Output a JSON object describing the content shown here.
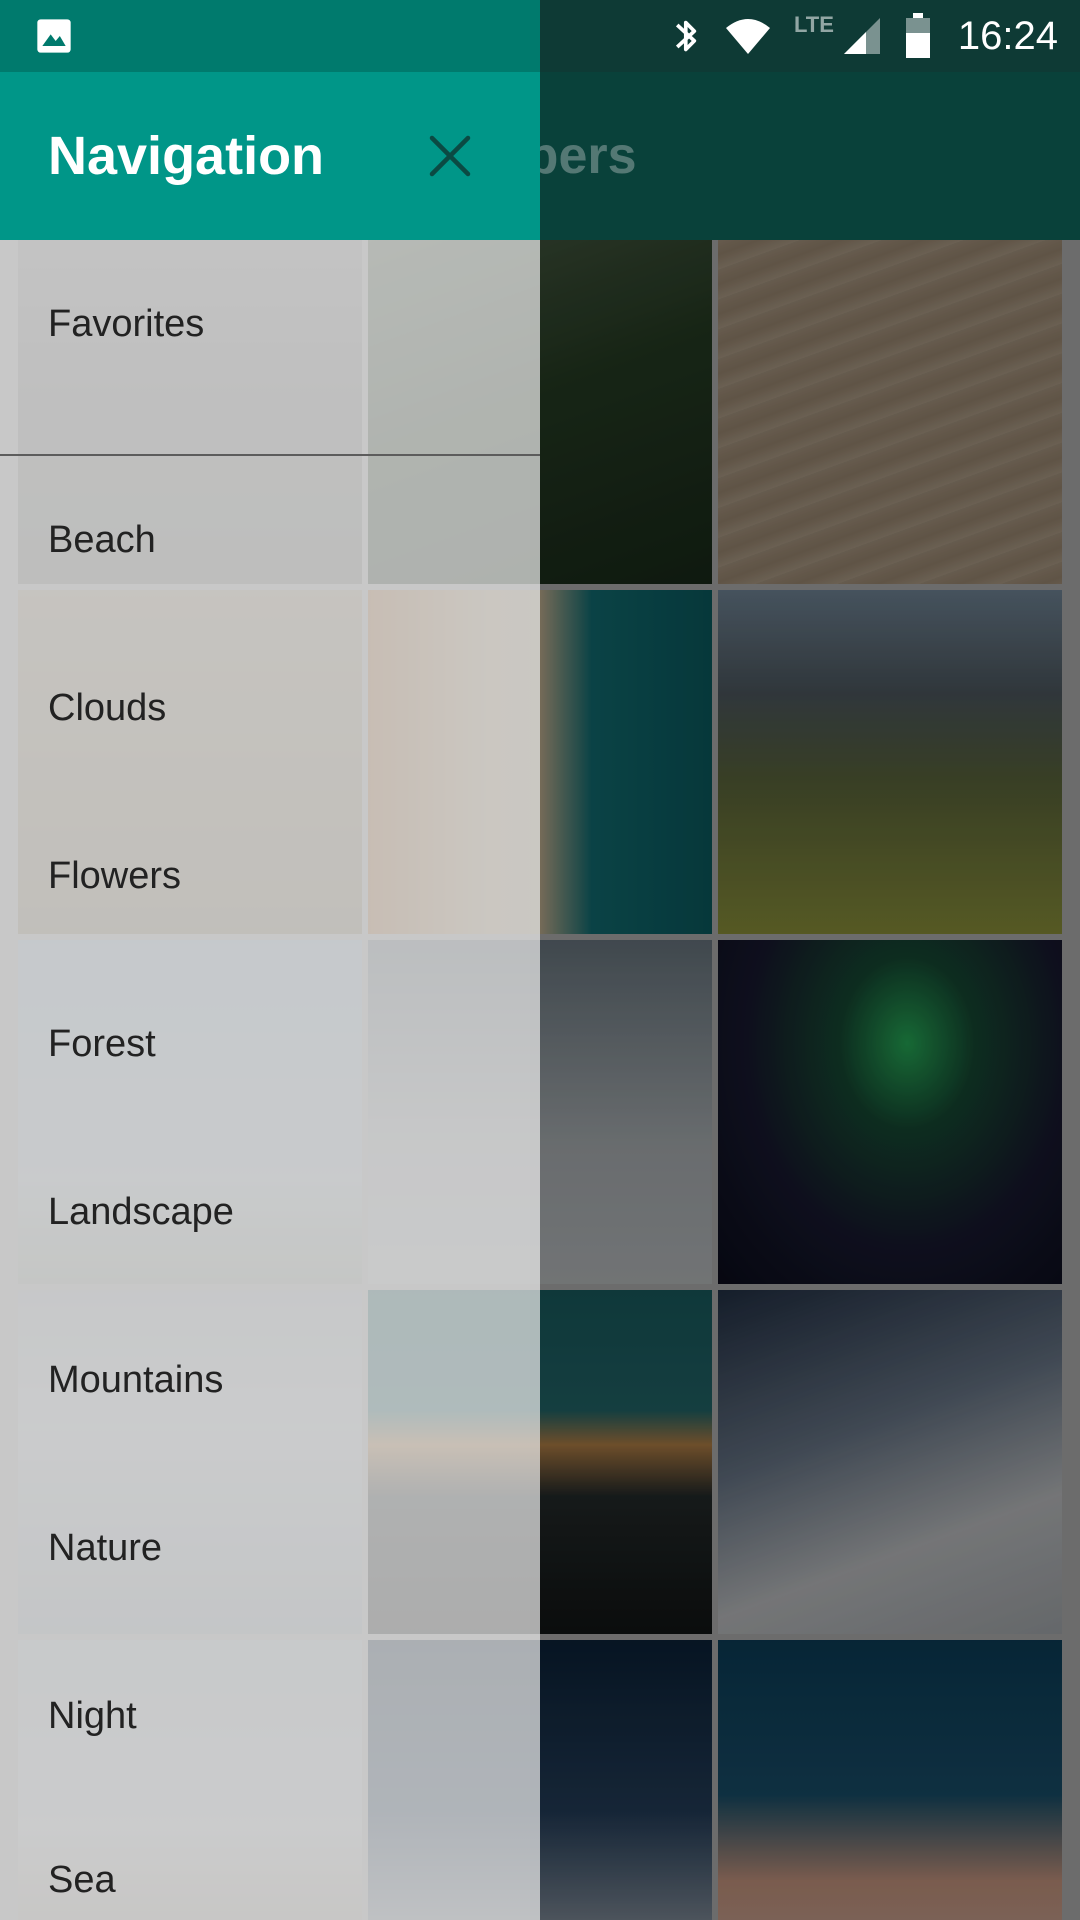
{
  "status_bar": {
    "time": "16:24",
    "network_label": "LTE",
    "icons": [
      "gallery-icon",
      "bluetooth-icon",
      "wifi-icon",
      "cellular-signal-icon",
      "battery-icon"
    ]
  },
  "app_bar": {
    "title_visible_fragment": "papers"
  },
  "drawer": {
    "title": "Navigation",
    "close_icon": "close-icon",
    "items": [
      {
        "label": "Favorites"
      },
      {
        "label": "Beach"
      },
      {
        "label": "Clouds"
      },
      {
        "label": "Flowers"
      },
      {
        "label": "Forest"
      },
      {
        "label": "Landscape"
      },
      {
        "label": "Mountains"
      },
      {
        "label": "Nature"
      },
      {
        "label": "Night"
      },
      {
        "label": "Sea"
      }
    ]
  },
  "colors": {
    "drawer_header": "#009688",
    "status_bar_left": "#007a6d",
    "status_bar_right": "#0e3a35",
    "app_bar_dimmed": "#0b4a43"
  }
}
